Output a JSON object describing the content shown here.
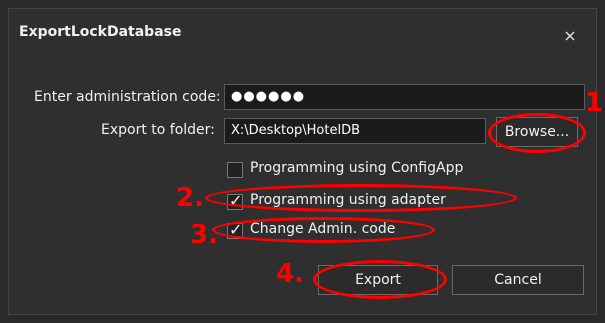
{
  "dialog": {
    "title": "ExportLockDatabase",
    "close_label": "×"
  },
  "form": {
    "admin_code_label": "Enter administration code:",
    "admin_code_value": "●●●●●●",
    "export_folder_label": "Export to folder:",
    "export_folder_value": "X:\\Desktop\\HotelDB",
    "browse_label": "Browse...",
    "options": [
      {
        "label": "Programming using ConfigApp",
        "checked": false
      },
      {
        "label": "Programming  using adapter",
        "checked": true
      },
      {
        "label": "Change Admin. code",
        "checked": true
      }
    ],
    "export_label": "Export",
    "cancel_label": "Cancel"
  },
  "annotations": {
    "color": "#ff0000",
    "steps": [
      "1.",
      "2.",
      "3.",
      "4."
    ]
  }
}
